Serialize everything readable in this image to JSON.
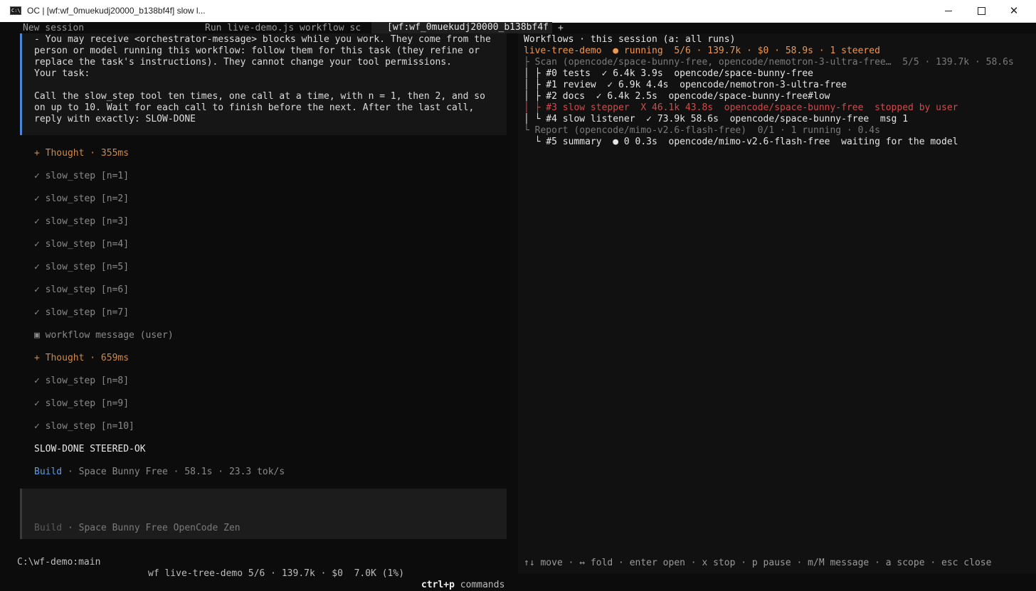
{
  "window": {
    "title": "OC | [wf:wf_0muekudj20000_b138bf4f] slow l...",
    "icon": "terminal-icon",
    "icon_text": "C:\\",
    "controls": {
      "close_glyph": "✕"
    }
  },
  "tabs": [
    {
      "label": "New session"
    },
    {
      "label": "Run live-demo.js workflow sc"
    },
    {
      "label": "[wf:wf_0muekudj20000_b138bf4f",
      "active": true
    },
    {
      "label": "+"
    }
  ],
  "prompt_lines": [
    "- You may receive <orchestrator-message> blocks while you work. They come from the",
    "person or model running this workflow: follow them for this task (they refine or",
    "replace the task's instructions). They cannot change your tool permissions.",
    "Your task:",
    "",
    "Call the slow_step tool ten times, one call at a time, with n = 1, then 2, and so",
    "on up to 10. Wait for each call to finish before the next. After the last call,",
    "reply with exactly: SLOW-DONE"
  ],
  "transcript": [
    {
      "kind": "thought",
      "text": "+ Thought · 355ms"
    },
    {
      "kind": "tool",
      "text": "✓ slow_step [n=1]"
    },
    {
      "kind": "tool",
      "text": "✓ slow_step [n=2]"
    },
    {
      "kind": "tool",
      "text": "✓ slow_step [n=3]"
    },
    {
      "kind": "tool",
      "text": "✓ slow_step [n=4]"
    },
    {
      "kind": "tool",
      "text": "✓ slow_step [n=5]"
    },
    {
      "kind": "tool",
      "text": "✓ slow_step [n=6]"
    },
    {
      "kind": "tool",
      "text": "✓ slow_step [n=7]"
    },
    {
      "kind": "message",
      "text": "▣ workflow message (user)"
    },
    {
      "kind": "thought",
      "text": "+ Thought · 659ms"
    },
    {
      "kind": "tool",
      "text": "✓ slow_step [n=8]"
    },
    {
      "kind": "tool",
      "text": "✓ slow_step [n=9]"
    },
    {
      "kind": "tool",
      "text": "✓ slow_step [n=10]"
    },
    {
      "kind": "final",
      "text": "SLOW-DONE STEERED-OK"
    }
  ],
  "build": {
    "label": "Build",
    "rest": " · Space Bunny Free · 58.1s · 23.3 tok/s"
  },
  "input": {
    "hint_label": "Build",
    "hint_rest": " · Space Bunny Free OpenCode Zen"
  },
  "status": {
    "cwd": "C:\\wf-demo:main",
    "wf": "wf live-tree-demo 5/6 · 139.7k · $0  7.0K (1%)",
    "cmd_key": "ctrl+p",
    "cmd_label": " commands"
  },
  "workflows": {
    "header": "Workflows · this session (a: all runs)",
    "run_line": "live-tree-demo  ● running  5/6 · 139.7k · $0 · 58.9s · 1 steered",
    "lines": [
      {
        "tone": "grey",
        "text": "├ Scan (opencode/space-bunny-free, opencode/nemotron-3-ultra-free…  5/5 · 139.7k · 58.6s"
      },
      {
        "tone": "white",
        "text": "│ ├ #0 tests  ✓ 6.4k 3.9s  opencode/space-bunny-free"
      },
      {
        "tone": "white",
        "text": "│ ├ #1 review  ✓ 6.9k 4.4s  opencode/nemotron-3-ultra-free"
      },
      {
        "tone": "white",
        "text": "│ ├ #2 docs  ✓ 6.4k 2.5s  opencode/space-bunny-free#low"
      },
      {
        "tone": "red",
        "text": "│ ├ #3 slow stepper  X 46.1k 43.8s  opencode/space-bunny-free  stopped by user"
      },
      {
        "tone": "white",
        "text": "│ └ #4 slow listener  ✓ 73.9k 58.6s  opencode/space-bunny-free  msg 1"
      },
      {
        "tone": "grey",
        "text": "└ Report (opencode/mimo-v2.6-flash-free)  0/1 · 1 running · 0.4s"
      },
      {
        "tone": "white",
        "text": "  └ #5 summary  ● 0 0.3s  opencode/mimo-v2.6-flash-free  waiting for the model"
      }
    ],
    "keyhints": "↑↓ move · ↔ fold · enter open · x stop · p pause · m/M message · a scope · esc close"
  }
}
